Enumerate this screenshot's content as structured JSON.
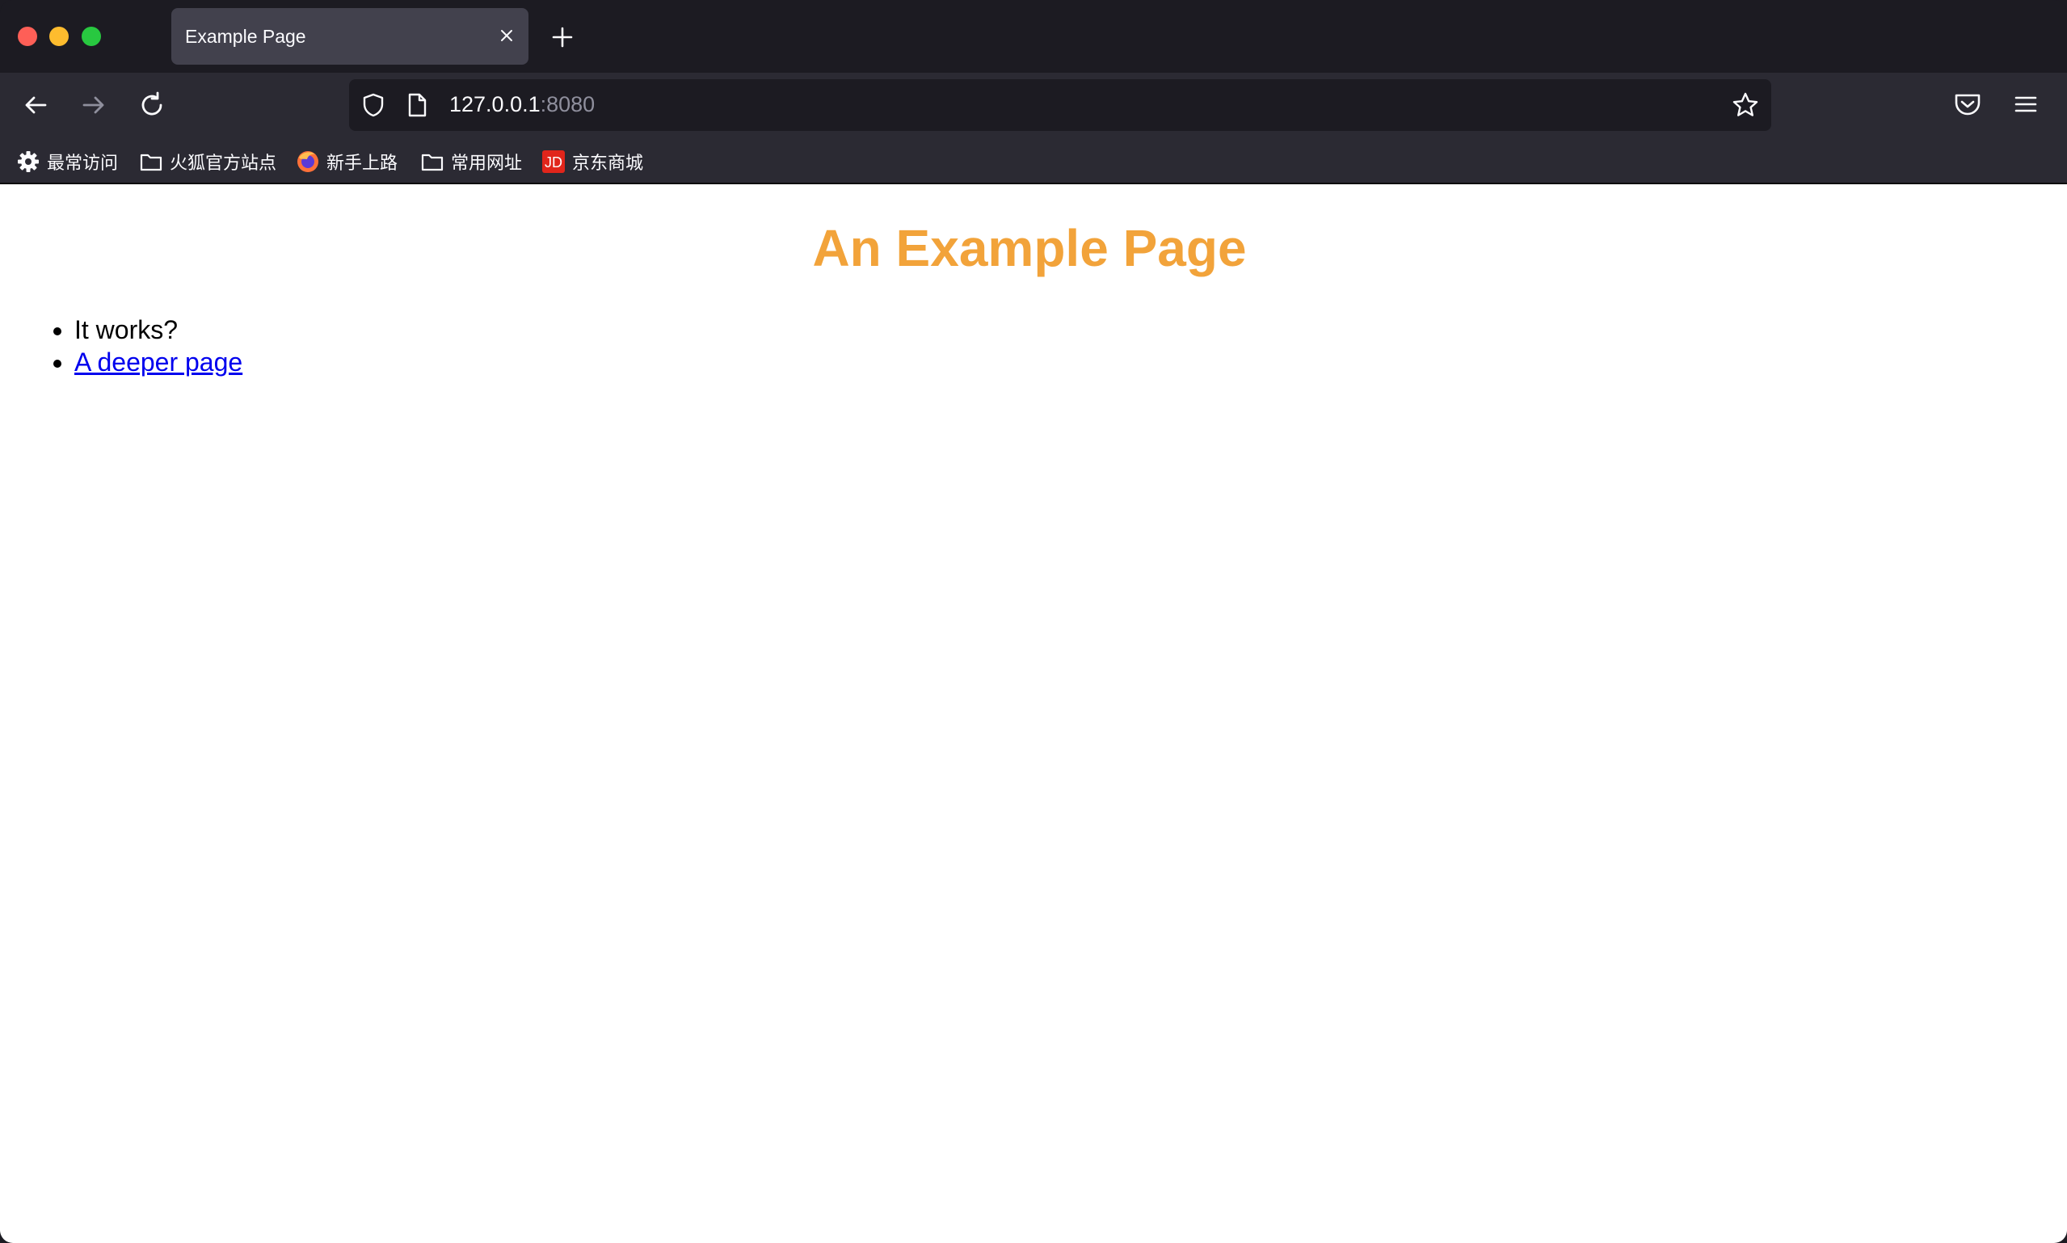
{
  "browser": {
    "tab": {
      "title": "Example Page"
    },
    "address": {
      "host": "127.0.0.1",
      "port": ":8080"
    },
    "bookmarks": [
      {
        "label": "最常访问",
        "icon": "gear-icon"
      },
      {
        "label": "火狐官方站点",
        "icon": "folder-icon"
      },
      {
        "label": "新手上路",
        "icon": "firefox-icon"
      },
      {
        "label": "常用网址",
        "icon": "folder-icon"
      },
      {
        "label": "京东商城",
        "icon": "jd-icon"
      }
    ],
    "jd_badge": "JD"
  },
  "page": {
    "title": "An Example Page",
    "items": [
      {
        "text": "It works?"
      },
      {
        "text": "A deeper page"
      }
    ],
    "title_color": "#f2a33a",
    "link_color": "#0000ee"
  }
}
